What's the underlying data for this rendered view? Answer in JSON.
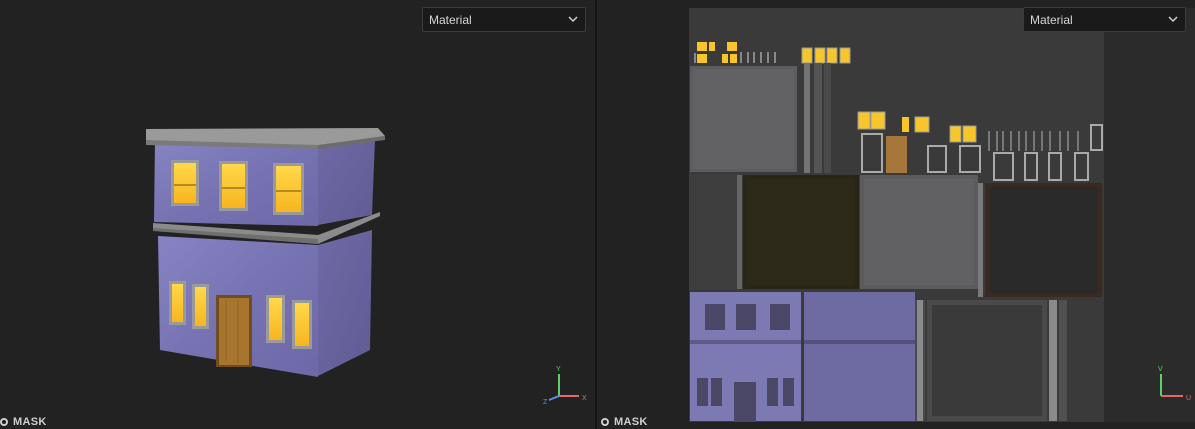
{
  "left_view": {
    "dropdown": {
      "selected": "Material"
    },
    "mask": {
      "label": "MASK"
    },
    "gizmo": {
      "y": "Y",
      "x": "X",
      "z": "Z"
    }
  },
  "right_view": {
    "dropdown": {
      "selected": "Material"
    },
    "mask": {
      "label": "MASK"
    },
    "gizmo": {
      "v": "V",
      "u": "U"
    }
  },
  "icons": [
    "chevron-down-icon",
    "mask-toggle-icon",
    "axis-gizmo-icon"
  ],
  "colors": {
    "panel_bg": "#222222",
    "wall": "#7d79b7",
    "window_glow": "#ffcf2e",
    "trim": "#909090",
    "door": "#9a6a2c",
    "axis_x": "#e06a6a",
    "axis_y": "#5fcf6a",
    "axis_z": "#5a8fe0"
  }
}
